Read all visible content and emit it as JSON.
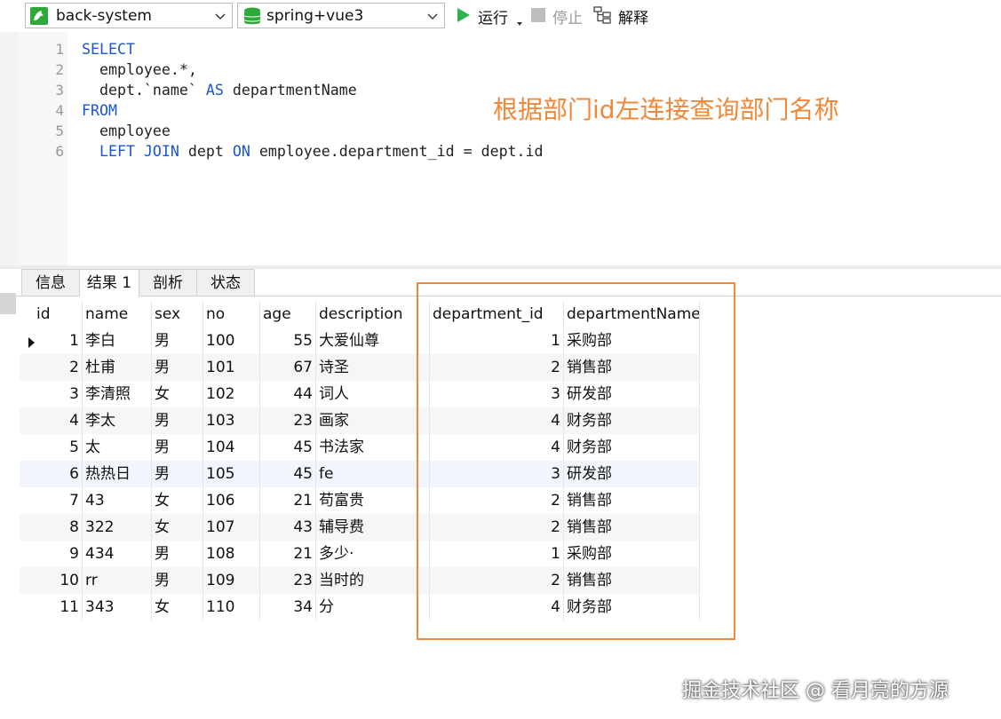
{
  "toolbar": {
    "connection": "back-system",
    "database": "spring+vue3",
    "run_label": "运行",
    "stop_label": "停止",
    "explain_label": "解释"
  },
  "editor": {
    "lines": [
      {
        "num": "1",
        "kw": "SELECT",
        "text": ""
      },
      {
        "num": "2",
        "kw": "",
        "text": "  employee.*,"
      },
      {
        "num": "3",
        "kw": "",
        "text": "  dept.`name` ",
        "kw2": "AS",
        "text2": " departmentName"
      },
      {
        "num": "4",
        "kw": "FROM",
        "text": ""
      },
      {
        "num": "5",
        "kw": "",
        "text": "  employee"
      },
      {
        "num": "6",
        "kw": "",
        "pre": "  ",
        "kw1": "LEFT JOIN",
        "mid": " dept ",
        "kw3": "ON",
        "text": " employee.department_id = dept.id"
      }
    ]
  },
  "annotation": "根据部门id左连接查询部门名称",
  "tabs": [
    {
      "label": "信息"
    },
    {
      "label": "结果 1"
    },
    {
      "label": "剖析"
    },
    {
      "label": "状态"
    }
  ],
  "grid": {
    "columns": [
      "id",
      "name",
      "sex",
      "no",
      "age",
      "description",
      "department_id",
      "departmentName"
    ],
    "rows": [
      [
        "1",
        "李白",
        "男",
        "100",
        "55",
        "大爱仙尊",
        "1",
        "采购部"
      ],
      [
        "2",
        "杜甫",
        "男",
        "101",
        "67",
        "诗圣",
        "2",
        "销售部"
      ],
      [
        "3",
        "李清照",
        "女",
        "102",
        "44",
        "词人",
        "3",
        "研发部"
      ],
      [
        "4",
        "李太",
        "男",
        "103",
        "23",
        "画家",
        "4",
        "财务部"
      ],
      [
        "5",
        "太",
        "男",
        "104",
        "45",
        "书法家",
        "4",
        "财务部"
      ],
      [
        "6",
        "热热日",
        "男",
        "105",
        "45",
        "fe",
        "3",
        "研发部"
      ],
      [
        "7",
        "43",
        "女",
        "106",
        "21",
        "苟富贵",
        "2",
        "销售部"
      ],
      [
        "8",
        "322",
        "女",
        "107",
        "43",
        "辅导费",
        "2",
        "销售部"
      ],
      [
        "9",
        "434",
        "男",
        "108",
        "21",
        "多少·",
        "1",
        "采购部"
      ],
      [
        "10",
        "rr",
        "男",
        "109",
        "23",
        "当时的",
        "2",
        "销售部"
      ],
      [
        "11",
        "343",
        "女",
        "110",
        "34",
        "分",
        "4",
        "财务部"
      ]
    ]
  },
  "watermark": "掘金技术社区 @ 看月亮的方源",
  "colors": {
    "keyword": "#1a55d8",
    "annotation": "#f0883a",
    "highlight_box": "#ee8a3c",
    "run_icon": "#2db34a",
    "db_icon": "#2fa83a"
  },
  "icons": {
    "connection": "dolphin-db-icon",
    "database": "database-stack-icon",
    "run": "play-icon",
    "stop": "stop-icon",
    "explain": "explain-icon"
  }
}
